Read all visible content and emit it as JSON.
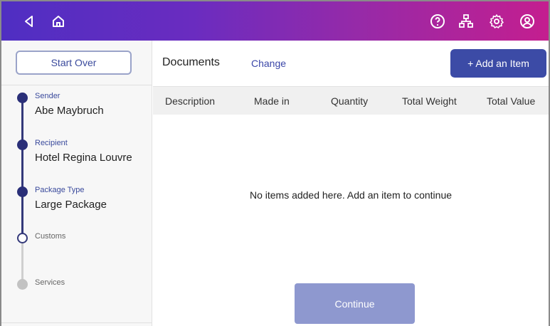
{
  "topbar": {
    "left_icons": [
      "back-icon",
      "home-icon"
    ],
    "right_icons": [
      "help-icon",
      "network-icon",
      "settings-icon",
      "account-icon"
    ],
    "gradient_colors": [
      "#4f2ec2",
      "#c41e8f"
    ]
  },
  "sidebar": {
    "start_over_label": "Start Over",
    "steps": [
      {
        "title": "Sender",
        "value": "Abe Maybruch",
        "state": "done"
      },
      {
        "title": "Recipient",
        "value": "Hotel Regina Louvre",
        "state": "done"
      },
      {
        "title": "Package Type",
        "value": "Large Package",
        "state": "done"
      },
      {
        "title": "Customs",
        "value": "",
        "state": "current"
      },
      {
        "title": "Services",
        "value": "",
        "state": "todo"
      }
    ]
  },
  "main": {
    "section_title": "Documents",
    "change_label": "Change",
    "add_item_label": "+ Add an Item",
    "columns": [
      "Description",
      "Made in",
      "Quantity",
      "Total Weight",
      "Total Value"
    ],
    "empty_message": "No items added here. Add an item to continue",
    "continue_label": "Continue"
  },
  "colors": {
    "primary": "#3c4ba6",
    "primary_disabled": "#8e98cf",
    "step_done": "#2a2f78",
    "step_todo": "#c2c2c2"
  }
}
